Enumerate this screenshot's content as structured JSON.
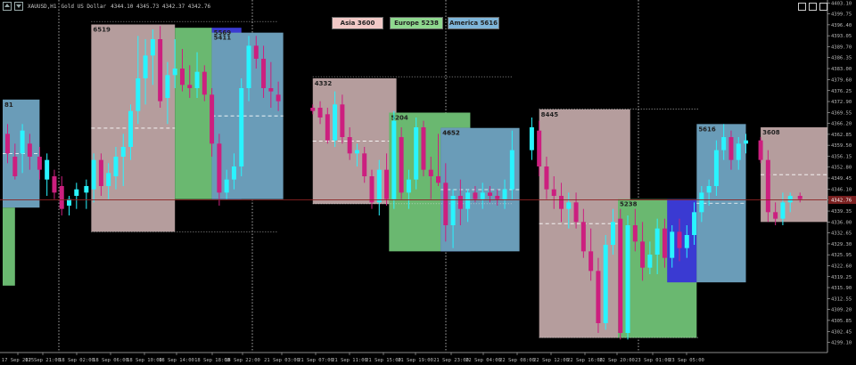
{
  "header": {
    "symbol": "XAUUSD,H1",
    "description": "Gold US Dollar",
    "ohlc": "4344.10 4345.73 4342.37 4342.76"
  },
  "session_buttons": [
    {
      "label": "Asia",
      "value": "3600",
      "color": "#f1c9c7"
    },
    {
      "label": "Europe",
      "value": "5238",
      "color": "#8fd88f"
    },
    {
      "label": "America",
      "value": "5616",
      "color": "#7fb6da"
    }
  ],
  "colors": {
    "asia": "#b59d9d",
    "europe": "#6ab870",
    "america": "#6a9cb8",
    "overlap": "#3a3ad2",
    "bull": "#29f4ff",
    "bear": "#cc1f7f",
    "background": "#000000",
    "price_line": "#8b2020",
    "current_price_bg": "#7a1f1f"
  },
  "chart_data": {
    "type": "candlestick",
    "symbol": "XAUUSD",
    "timeframe": "H1",
    "current_price": "4342.76",
    "ylim": [
      4296,
      4404
    ],
    "y_ticks": [
      "4403.10",
      "4399.75",
      "4396.40",
      "4393.05",
      "4389.70",
      "4386.35",
      "4383.00",
      "4379.60",
      "4376.25",
      "4372.90",
      "4369.55",
      "4366.20",
      "4362.85",
      "4359.50",
      "4356.15",
      "4352.80",
      "4349.45",
      "4346.10",
      "4342.75",
      "4339.35",
      "4336.00",
      "4332.65",
      "4329.30",
      "4325.95",
      "4322.60",
      "4319.25",
      "4315.90",
      "4312.55",
      "4309.20",
      "4305.85",
      "4302.45",
      "4299.10"
    ],
    "x_ticks": [
      "17 Sep 2025",
      "17 Sep 21:00",
      "18 Sep 02:00",
      "18 Sep 06:00",
      "18 Sep 10:00",
      "18 Sep 14:00",
      "18 Sep 18:00",
      "18 Sep 22:00",
      "21 Sep 03:00",
      "21 Sep 07:00",
      "21 Sep 11:00",
      "21 Sep 15:00",
      "21 Sep 19:00",
      "21 Sep 23:00",
      "22 Sep 04:00",
      "22 Sep 08:00",
      "22 Sep 12:00",
      "22 Sep 16:00",
      "22 Sep 20:00",
      "23 Sep 01:00",
      "23 Sep 05:00"
    ],
    "session_boxes": [
      {
        "session": "america",
        "label": "81",
        "x_start": 0,
        "x_end": 1.5,
        "high": 4373.5,
        "low": 4340.4
      },
      {
        "session": "europe",
        "label": "",
        "x_start": 0,
        "x_end": 0.5,
        "high": 4340.4,
        "low": 4316.5
      },
      {
        "session": "asia",
        "label": "6519",
        "x_start": 3.6,
        "x_end": 7.0,
        "high": 4396.5,
        "low": 4333.0
      },
      {
        "session": "europe",
        "label": "",
        "x_start": 7.0,
        "x_end": 8.5,
        "high": 4395.5,
        "low": 4343.0
      },
      {
        "session": "overlap",
        "label": "5569",
        "x_start": 8.5,
        "x_end": 9.7,
        "high": 4395.5,
        "low": 4343.0
      },
      {
        "session": "america",
        "label": "5411",
        "x_start": 8.5,
        "x_end": 11.4,
        "high": 4394.0,
        "low": 4343.0
      },
      {
        "session": "asia",
        "label": "4332",
        "x_start": 12.6,
        "x_end": 16.0,
        "high": 4380.0,
        "low": 4341.5
      },
      {
        "session": "europe",
        "label": "5204",
        "x_start": 15.7,
        "x_end": 19.0,
        "high": 4369.5,
        "low": 4327.0
      },
      {
        "session": "overlap",
        "label": "4652",
        "x_start": 17.8,
        "x_end": 19.0,
        "high": 4364.8,
        "low": 4327.0
      },
      {
        "session": "america",
        "label": "4652",
        "x_start": 17.8,
        "x_end": 21.0,
        "high": 4364.8,
        "low": 4327.0
      },
      {
        "session": "asia",
        "label": "8445",
        "x_start": 21.8,
        "x_end": 25.5,
        "high": 4370.5,
        "low": 4300.5
      },
      {
        "session": "europe",
        "label": "5238",
        "x_start": 25.0,
        "x_end": 28.2,
        "high": 4343.0,
        "low": 4300.5
      },
      {
        "session": "overlap",
        "label": "",
        "x_start": 27.0,
        "x_end": 28.2,
        "high": 4343.0,
        "low": 4317.5
      },
      {
        "session": "america",
        "label": "5616",
        "x_start": 28.2,
        "x_end": 30.2,
        "high": 4366.0,
        "low": 4317.5
      },
      {
        "session": "asia",
        "label": "3608",
        "x_start": 30.8,
        "x_end": 34.6,
        "high": 4365.0,
        "low": 4336.0
      }
    ],
    "candles": [
      {
        "i": 0.2,
        "o": 4363,
        "h": 4366,
        "l": 4354,
        "c": 4357
      },
      {
        "i": 0.5,
        "o": 4356,
        "h": 4360,
        "l": 4349,
        "c": 4350
      },
      {
        "i": 0.8,
        "o": 4357,
        "h": 4366,
        "l": 4351,
        "c": 4364
      },
      {
        "i": 1.1,
        "o": 4360,
        "h": 4363,
        "l": 4352,
        "c": 4356
      },
      {
        "i": 1.5,
        "o": 4356,
        "h": 4359,
        "l": 4349,
        "c": 4352
      },
      {
        "i": 1.8,
        "o": 4349,
        "h": 4357,
        "l": 4344,
        "c": 4355
      },
      {
        "i": 2.1,
        "o": 4350,
        "h": 4352,
        "l": 4343,
        "c": 4345
      },
      {
        "i": 2.4,
        "o": 4347,
        "h": 4350,
        "l": 4338,
        "c": 4340
      },
      {
        "i": 2.7,
        "o": 4341,
        "h": 4344,
        "l": 4338,
        "c": 4343
      },
      {
        "i": 3.0,
        "o": 4344,
        "h": 4348,
        "l": 4340,
        "c": 4346
      },
      {
        "i": 3.4,
        "o": 4345,
        "h": 4349,
        "l": 4340,
        "c": 4347
      },
      {
        "i": 3.7,
        "o": 4346,
        "h": 4357,
        "l": 4342,
        "c": 4355
      },
      {
        "i": 4.0,
        "o": 4355,
        "h": 4357,
        "l": 4344,
        "c": 4347
      },
      {
        "i": 4.3,
        "o": 4347,
        "h": 4354,
        "l": 4343,
        "c": 4351
      },
      {
        "i": 4.6,
        "o": 4350,
        "h": 4359,
        "l": 4346,
        "c": 4356
      },
      {
        "i": 4.9,
        "o": 4356,
        "h": 4363,
        "l": 4347,
        "c": 4359
      },
      {
        "i": 5.2,
        "o": 4359,
        "h": 4372,
        "l": 4355,
        "c": 4370
      },
      {
        "i": 5.5,
        "o": 4370,
        "h": 4393,
        "l": 4366,
        "c": 4380
      },
      {
        "i": 5.8,
        "o": 4380,
        "h": 4392,
        "l": 4372,
        "c": 4387
      },
      {
        "i": 6.1,
        "o": 4387,
        "h": 4395,
        "l": 4378,
        "c": 4392
      },
      {
        "i": 6.4,
        "o": 4392,
        "h": 4396,
        "l": 4371,
        "c": 4373
      },
      {
        "i": 6.7,
        "o": 4374,
        "h": 4385,
        "l": 4366,
        "c": 4381
      },
      {
        "i": 7.0,
        "o": 4381,
        "h": 4392,
        "l": 4377,
        "c": 4383
      },
      {
        "i": 7.3,
        "o": 4383,
        "h": 4389,
        "l": 4376,
        "c": 4378
      },
      {
        "i": 7.6,
        "o": 4378,
        "h": 4384,
        "l": 4374,
        "c": 4377
      },
      {
        "i": 7.9,
        "o": 4377,
        "h": 4388,
        "l": 4374,
        "c": 4382
      },
      {
        "i": 8.2,
        "o": 4382,
        "h": 4384,
        "l": 4373,
        "c": 4375
      },
      {
        "i": 8.5,
        "o": 4375,
        "h": 4377,
        "l": 4356,
        "c": 4360
      },
      {
        "i": 8.8,
        "o": 4360,
        "h": 4363,
        "l": 4341,
        "c": 4345
      },
      {
        "i": 9.1,
        "o": 4345,
        "h": 4352,
        "l": 4343,
        "c": 4349
      },
      {
        "i": 9.4,
        "o": 4349,
        "h": 4357,
        "l": 4346,
        "c": 4353
      },
      {
        "i": 9.7,
        "o": 4353,
        "h": 4380,
        "l": 4350,
        "c": 4377
      },
      {
        "i": 10.0,
        "o": 4377,
        "h": 4393,
        "l": 4373,
        "c": 4390
      },
      {
        "i": 10.3,
        "o": 4390,
        "h": 4393,
        "l": 4383,
        "c": 4386
      },
      {
        "i": 10.6,
        "o": 4386,
        "h": 4390,
        "l": 4374,
        "c": 4377
      },
      {
        "i": 10.9,
        "o": 4377,
        "h": 4385,
        "l": 4371,
        "c": 4376
      },
      {
        "i": 11.2,
        "o": 4375,
        "h": 4379,
        "l": 4370,
        "c": 4373
      },
      {
        "i": 12.6,
        "o": 4371,
        "h": 4372,
        "l": 4369,
        "c": 4370
      },
      {
        "i": 12.9,
        "o": 4371,
        "h": 4373,
        "l": 4366,
        "c": 4368
      },
      {
        "i": 13.2,
        "o": 4369,
        "h": 4371,
        "l": 4360,
        "c": 4361
      },
      {
        "i": 13.5,
        "o": 4361,
        "h": 4376,
        "l": 4359,
        "c": 4372
      },
      {
        "i": 13.8,
        "o": 4372,
        "h": 4375,
        "l": 4360,
        "c": 4362
      },
      {
        "i": 14.1,
        "o": 4362,
        "h": 4365,
        "l": 4355,
        "c": 4357
      },
      {
        "i": 14.4,
        "o": 4357,
        "h": 4360,
        "l": 4353,
        "c": 4358
      },
      {
        "i": 14.7,
        "o": 4357,
        "h": 4359,
        "l": 4348,
        "c": 4350
      },
      {
        "i": 15.0,
        "o": 4350,
        "h": 4352,
        "l": 4340,
        "c": 4342
      },
      {
        "i": 15.3,
        "o": 4342,
        "h": 4355,
        "l": 4338,
        "c": 4352
      },
      {
        "i": 15.6,
        "o": 4352,
        "h": 4357,
        "l": 4341,
        "c": 4343
      },
      {
        "i": 15.9,
        "o": 4343,
        "h": 4370,
        "l": 4340,
        "c": 4367
      },
      {
        "i": 16.2,
        "o": 4362,
        "h": 4365,
        "l": 4343,
        "c": 4345
      },
      {
        "i": 16.5,
        "o": 4345,
        "h": 4352,
        "l": 4340,
        "c": 4349
      },
      {
        "i": 16.8,
        "o": 4349,
        "h": 4368,
        "l": 4346,
        "c": 4365
      },
      {
        "i": 17.1,
        "o": 4365,
        "h": 4367,
        "l": 4350,
        "c": 4352
      },
      {
        "i": 17.4,
        "o": 4352,
        "h": 4356,
        "l": 4343,
        "c": 4350
      },
      {
        "i": 17.7,
        "o": 4350,
        "h": 4363,
        "l": 4347,
        "c": 4348
      },
      {
        "i": 18.0,
        "o": 4348,
        "h": 4354,
        "l": 4330,
        "c": 4335
      },
      {
        "i": 18.3,
        "o": 4335,
        "h": 4346,
        "l": 4328,
        "c": 4344
      },
      {
        "i": 18.6,
        "o": 4344,
        "h": 4349,
        "l": 4335,
        "c": 4340
      },
      {
        "i": 18.9,
        "o": 4340,
        "h": 4346,
        "l": 4336,
        "c": 4345
      },
      {
        "i": 19.2,
        "o": 4345,
        "h": 4347,
        "l": 4342,
        "c": 4343
      },
      {
        "i": 19.5,
        "o": 4343,
        "h": 4348,
        "l": 4340,
        "c": 4345
      },
      {
        "i": 19.8,
        "o": 4345,
        "h": 4347,
        "l": 4342,
        "c": 4344
      },
      {
        "i": 20.1,
        "o": 4344,
        "h": 4346,
        "l": 4341,
        "c": 4343
      },
      {
        "i": 20.4,
        "o": 4343,
        "h": 4349,
        "l": 4340,
        "c": 4346
      },
      {
        "i": 20.7,
        "o": 4346,
        "h": 4364,
        "l": 4343,
        "c": 4358
      },
      {
        "i": 21.5,
        "o": 4358,
        "h": 4368,
        "l": 4355,
        "c": 4365
      },
      {
        "i": 21.8,
        "o": 4364,
        "h": 4367,
        "l": 4350,
        "c": 4353
      },
      {
        "i": 22.1,
        "o": 4353,
        "h": 4356,
        "l": 4343,
        "c": 4346
      },
      {
        "i": 22.4,
        "o": 4346,
        "h": 4350,
        "l": 4340,
        "c": 4344
      },
      {
        "i": 22.7,
        "o": 4344,
        "h": 4348,
        "l": 4336,
        "c": 4340
      },
      {
        "i": 23.0,
        "o": 4340,
        "h": 4345,
        "l": 4334,
        "c": 4342
      },
      {
        "i": 23.3,
        "o": 4342,
        "h": 4345,
        "l": 4334,
        "c": 4336
      },
      {
        "i": 23.6,
        "o": 4336,
        "h": 4340,
        "l": 4325,
        "c": 4327
      },
      {
        "i": 23.9,
        "o": 4327,
        "h": 4334,
        "l": 4318,
        "c": 4321
      },
      {
        "i": 24.2,
        "o": 4321,
        "h": 4325,
        "l": 4302,
        "c": 4305
      },
      {
        "i": 24.5,
        "o": 4305,
        "h": 4332,
        "l": 4303,
        "c": 4329
      },
      {
        "i": 24.8,
        "o": 4329,
        "h": 4340,
        "l": 4326,
        "c": 4336
      },
      {
        "i": 25.1,
        "o": 4337,
        "h": 4340,
        "l": 4300,
        "c": 4302
      },
      {
        "i": 25.4,
        "o": 4302,
        "h": 4338,
        "l": 4300,
        "c": 4335
      },
      {
        "i": 25.7,
        "o": 4335,
        "h": 4340,
        "l": 4327,
        "c": 4330
      },
      {
        "i": 26.0,
        "o": 4330,
        "h": 4336,
        "l": 4318,
        "c": 4322
      },
      {
        "i": 26.3,
        "o": 4322,
        "h": 4330,
        "l": 4320,
        "c": 4326
      },
      {
        "i": 26.6,
        "o": 4326,
        "h": 4337,
        "l": 4320,
        "c": 4334
      },
      {
        "i": 26.9,
        "o": 4334,
        "h": 4337,
        "l": 4322,
        "c": 4325
      },
      {
        "i": 27.2,
        "o": 4325,
        "h": 4335,
        "l": 4322,
        "c": 4333
      },
      {
        "i": 27.5,
        "o": 4333,
        "h": 4337,
        "l": 4324,
        "c": 4328
      },
      {
        "i": 27.8,
        "o": 4328,
        "h": 4335,
        "l": 4325,
        "c": 4332
      },
      {
        "i": 28.1,
        "o": 4332,
        "h": 4342,
        "l": 4329,
        "c": 4339
      },
      {
        "i": 28.4,
        "o": 4339,
        "h": 4347,
        "l": 4336,
        "c": 4345
      },
      {
        "i": 28.7,
        "o": 4345,
        "h": 4349,
        "l": 4341,
        "c": 4347
      },
      {
        "i": 29.0,
        "o": 4347,
        "h": 4361,
        "l": 4344,
        "c": 4358
      },
      {
        "i": 29.3,
        "o": 4358,
        "h": 4366,
        "l": 4355,
        "c": 4362
      },
      {
        "i": 29.6,
        "o": 4362,
        "h": 4364,
        "l": 4352,
        "c": 4355
      },
      {
        "i": 29.9,
        "o": 4355,
        "h": 4362,
        "l": 4352,
        "c": 4360
      },
      {
        "i": 30.2,
        "o": 4360,
        "h": 4363,
        "l": 4357,
        "c": 4361
      },
      {
        "i": 30.8,
        "o": 4361,
        "h": 4362,
        "l": 4354,
        "c": 4355
      },
      {
        "i": 31.1,
        "o": 4355,
        "h": 4358,
        "l": 4336,
        "c": 4339
      },
      {
        "i": 31.4,
        "o": 4339,
        "h": 4342,
        "l": 4335,
        "c": 4337
      },
      {
        "i": 31.7,
        "o": 4337,
        "h": 4345,
        "l": 4335,
        "c": 4342
      },
      {
        "i": 32.0,
        "o": 4342,
        "h": 4345,
        "l": 4339,
        "c": 4344
      },
      {
        "i": 32.4,
        "o": 4344,
        "h": 4345,
        "l": 4342,
        "c": 4343
      }
    ]
  }
}
